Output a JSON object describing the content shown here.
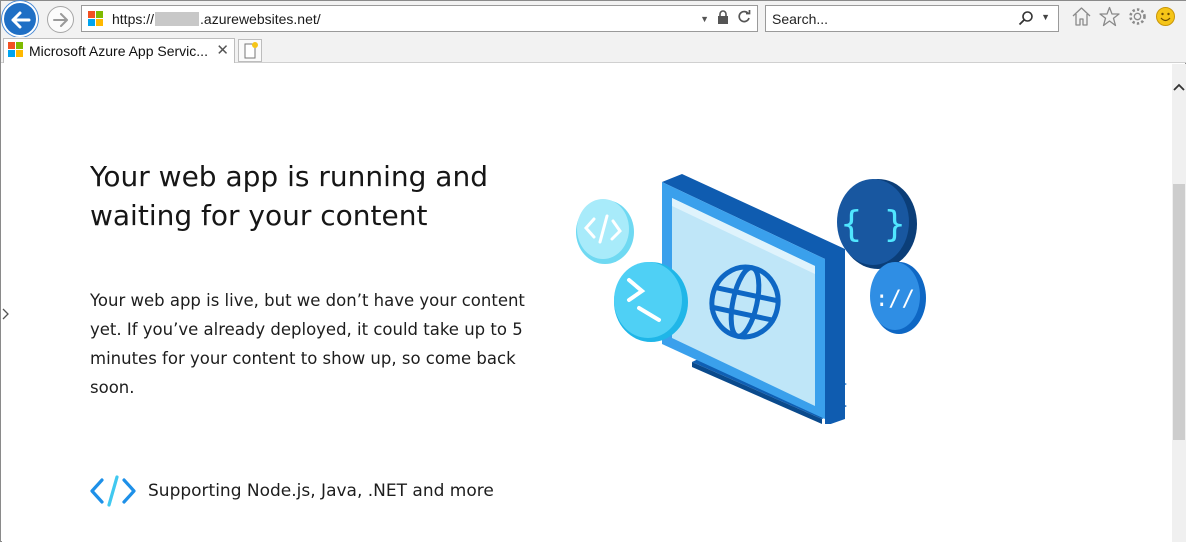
{
  "browser": {
    "address": {
      "url_prefix": "https://",
      "url_suffix": ".azurewebsites.net/"
    },
    "search": {
      "placeholder": "Search..."
    },
    "tab": {
      "title": "Microsoft Azure App Servic..."
    },
    "icons": [
      "back-arrow-icon",
      "forward-arrow-icon",
      "dropdown-arrow-icon",
      "lock-icon",
      "refresh-icon",
      "search-icon",
      "home-icon",
      "star-icon",
      "gear-icon",
      "smiley-icon",
      "close-icon",
      "new-tab-icon"
    ]
  },
  "page": {
    "headline": "Your web app is running and waiting for your content",
    "body": "Your web app is live, but we don’t have your content yet. If you’ve already deployed, it could take up to 5 minutes for your content to show up, so come back soon.",
    "feature": "Supporting Node.js, Java, .NET and more"
  },
  "colors": {
    "ms_red": "#f25022",
    "ms_green": "#7fba00",
    "ms_blue": "#00a4ef",
    "ms_yellow": "#ffb900",
    "back_button": "#1f6fc5",
    "azure_blue": "#0078d4",
    "light_blue": "#50e6ff"
  }
}
